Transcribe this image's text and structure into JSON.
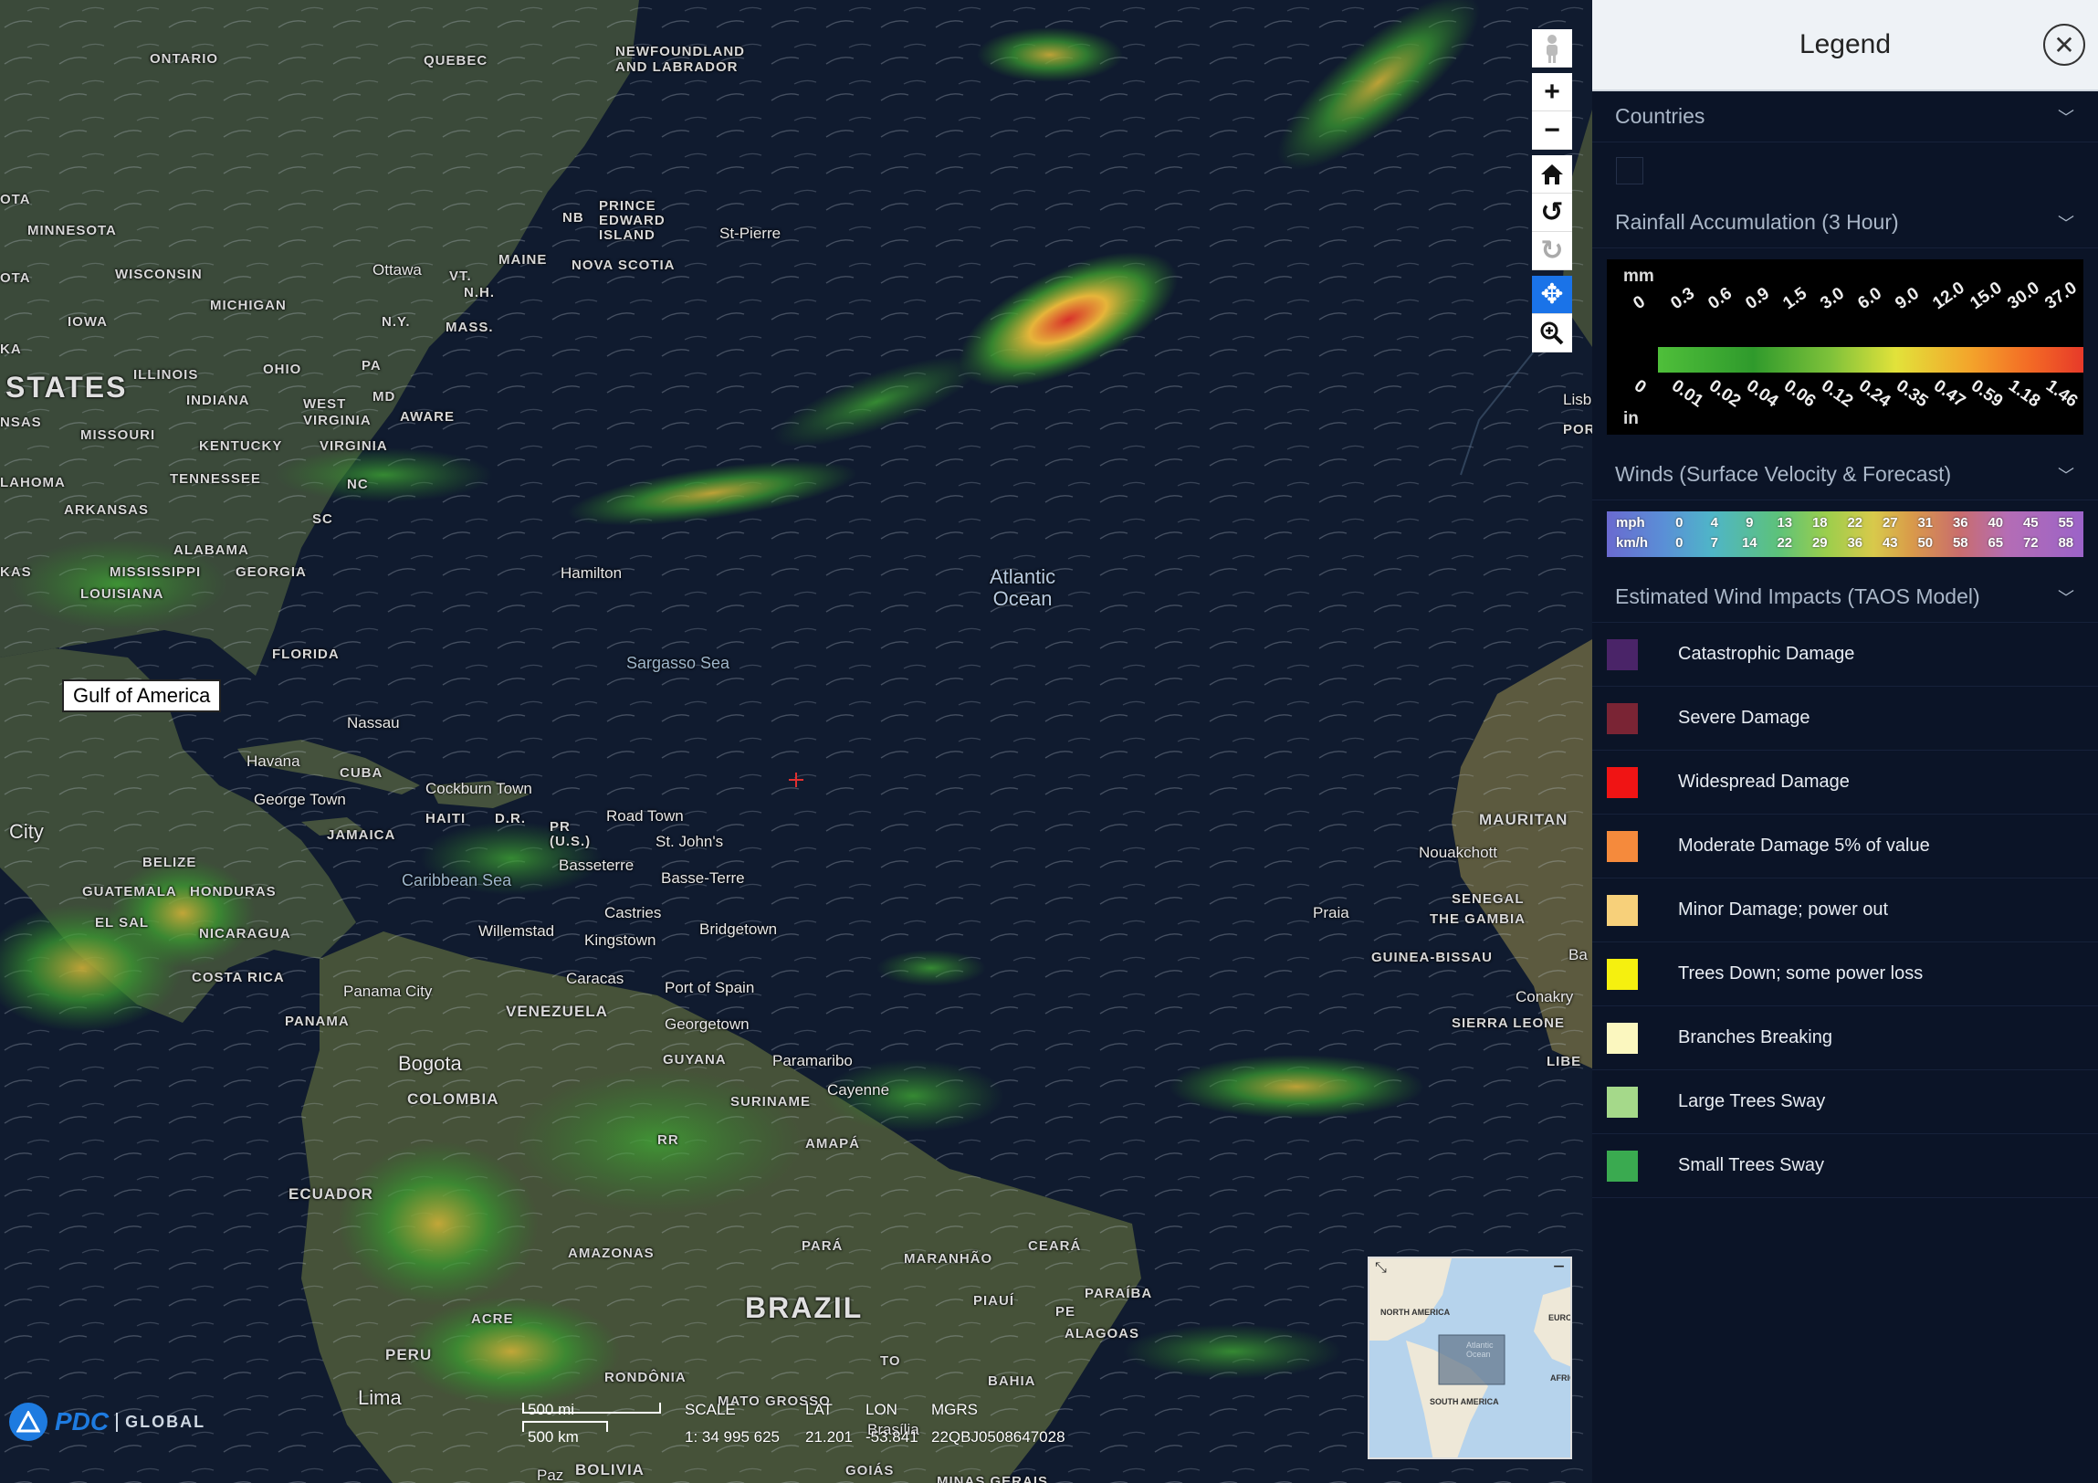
{
  "map": {
    "labels": {
      "ontario": "ONTARIO",
      "quebec": "QUEBEC",
      "newfoundland": "NEWFOUNDLAND\nAND LABRADOR",
      "minnesota": "MINNESOTA",
      "wisconsin": "WISCONSIN",
      "michigan": "MICHIGAN",
      "iowa": "IOWA",
      "illinois": "ILLINOIS",
      "ohio": "OHIO",
      "indiana": "INDIANA",
      "states": "STATES",
      "missouri": "MISSOURI",
      "kentucky": "KENTUCKY",
      "west_virginia": "WEST\nVIRGINIA",
      "virginia": "VIRGINIA",
      "tennessee": "TENNESSEE",
      "arkansas": "ARKANSAS",
      "oklahoma": "LAHOMA",
      "alabama": "ALABAMA",
      "mississippi": "MISSISSIPPI",
      "georgia": "GEORGIA",
      "louisiana": "LOUISIANA",
      "florida": "FLORIDA",
      "pa": "PA",
      "ny": "N.Y.",
      "mass": "MASS.",
      "vt": "VT.",
      "nh": "N.H.",
      "maine": "MAINE",
      "nc": "NC",
      "sc": "SC",
      "md": "MD",
      "aware": "AWARE",
      "ota": "OTA",
      "ota2": "OTA",
      "ka": "KA",
      "nsas": "NSAS",
      "kas": "KAS",
      "nb": "NB",
      "pei": "PRINCE\nEDWARD\nISLAND",
      "nova_scotia": "NOVA SCOTIA",
      "ottawa": "Ottawa",
      "st_pierre": "St-Pierre",
      "hamilton": "Hamilton",
      "atlantic_ocean": "Atlantic\nOcean",
      "sargasso": "Sargasso Sea",
      "nassau": "Nassau",
      "havana": "Havana",
      "cuba": "CUBA",
      "cockburn": "Cockburn Town",
      "george_town": "George Town",
      "haiti": "HAITI",
      "dr": "D.R.",
      "jamaica": "JAMAICA",
      "pr": "PR\n(U.S.)",
      "road_town": "Road Town",
      "st_johns": "St. John's",
      "basseterre": "Basseterre",
      "basse_terre": "Basse-Terre",
      "caribbean": "Caribbean Sea",
      "castries": "Castries",
      "kingstown": "Kingstown",
      "bridgetown": "Bridgetown",
      "willemstad": "Willemstad",
      "caracas": "Caracas",
      "port_of_spain": "Port of Spain",
      "belize": "BELIZE",
      "honduras": "HONDURAS",
      "guatemala": "GUATEMALA",
      "el_salvador": "EL SAL",
      "nicaragua": "NICARAGUA",
      "costa_rica": "COSTA RICA",
      "panama": "PANAMA",
      "panama_city": "Panama City",
      "city": "City",
      "venezuela": "VENEZUELA",
      "georgetown": "Georgetown",
      "guyana": "GUYANA",
      "paramaribo": "Paramaribo",
      "suriname": "SURINAME",
      "cayenne": "Cayenne",
      "bogota": "Bogota",
      "colombia": "COLOMBIA",
      "rr": "RR",
      "amapa": "AMAPÁ",
      "ecuador": "ECUADOR",
      "amazonas": "AMAZONAS",
      "para": "PARÁ",
      "maranhao": "MARANHÃO",
      "ceara": "CEARÁ",
      "piaui": "PIAUÍ",
      "pe": "PE",
      "paraiba": "PARAÍBA",
      "alagoas": "ALAGOAS",
      "brazil": "BRAZIL",
      "acre": "ACRE",
      "peru": "PERU",
      "rondonia": "RONDÔNIA",
      "mato_grosso": "MATO GROSSO",
      "to": "TO",
      "bahia": "BAHIA",
      "brasilia": "Brasília",
      "goias": "GOIÁS",
      "minas": "MINAS GERAIS",
      "bolivia": "BOLIVIA",
      "paz": "Paz",
      "lima": "Lima",
      "mauritania": "MAURITAN",
      "nouakchott": "Nouakchott",
      "senegal": "SENEGAL",
      "gambia": "THE GAMBIA",
      "praia": "Praia",
      "guinea_bissau": "GUINEA-BISSAU",
      "conakry": "Conakry",
      "sierra_leone": "SIERRA LEONE",
      "liberia": "LIBE",
      "ba": "Ba",
      "lisbon": "Lisb",
      "portugal": "PORT"
    },
    "gulf_label": "Gulf of America",
    "toolbar": {
      "pegman": "pegman-icon",
      "zoom_in": "+",
      "zoom_out": "−",
      "home": "⌂",
      "rotate_left": "↺",
      "rotate_right": "↻",
      "pan": "✥",
      "zoom_area": "⊕"
    },
    "scale": {
      "mi": "500 mi",
      "km": "500 km"
    },
    "coords": {
      "scale_label": "SCALE",
      "lat_label": "LAT",
      "lon_label": "LON",
      "mgrs_label": "MGRS",
      "scale_value": "1: 34 995 625",
      "lat_value": "21.201",
      "lon_value": "-53.841",
      "mgrs_value": "22QBJ0508647028"
    },
    "brand": {
      "name": "PDC",
      "product": "GLOBAL"
    },
    "overview": {
      "north_america": "NORTH AMERICA",
      "south_america": "SOUTH AMERICA",
      "europe": "EUROP",
      "africa": "AFRICA",
      "atlantic": "Atlantic\nOcean"
    }
  },
  "panel": {
    "title": "Legend",
    "close": "✕",
    "sections": {
      "countries": "Countries",
      "rainfall": "Rainfall Accumulation (3 Hour)",
      "winds": "Winds (Surface Velocity & Forecast)",
      "impacts": "Estimated Wind Impacts (TAOS Model)"
    },
    "rainfall": {
      "mm_label": "mm",
      "in_label": "in",
      "mm_ticks": [
        "0",
        "0.3",
        "0.6",
        "0.9",
        "1.5",
        "3.0",
        "6.0",
        "9.0",
        "12.0",
        "15.0",
        "30.0",
        "37.0"
      ],
      "in_ticks": [
        "0",
        "0.01",
        "0.02",
        "0.04",
        "0.06",
        "0.12",
        "0.24",
        "0.35",
        "0.47",
        "0.59",
        "1.18",
        "1.46"
      ]
    },
    "winds": {
      "mph_label": "mph",
      "kmh_label": "km/h",
      "mph": [
        "0",
        "4",
        "9",
        "13",
        "18",
        "22",
        "27",
        "31",
        "36",
        "40",
        "45",
        "55"
      ],
      "kmh": [
        "0",
        "7",
        "14",
        "22",
        "29",
        "36",
        "43",
        "50",
        "58",
        "65",
        "72",
        "88"
      ]
    },
    "impacts": [
      {
        "label": "Catastrophic Damage",
        "color": "#4a2468"
      },
      {
        "label": "Severe Damage",
        "color": "#7a2434"
      },
      {
        "label": "Widespread Damage",
        "color": "#f01414"
      },
      {
        "label": "Moderate Damage 5% of value",
        "color": "#f58a3c"
      },
      {
        "label": "Minor Damage; power out",
        "color": "#f7d07a"
      },
      {
        "label": "Trees Down; some power loss",
        "color": "#f5f00f"
      },
      {
        "label": "Branches Breaking",
        "color": "#fbf7bf"
      },
      {
        "label": "Large Trees Sway",
        "color": "#a5d98a"
      },
      {
        "label": "Small Trees Sway",
        "color": "#3aaa50"
      }
    ]
  }
}
